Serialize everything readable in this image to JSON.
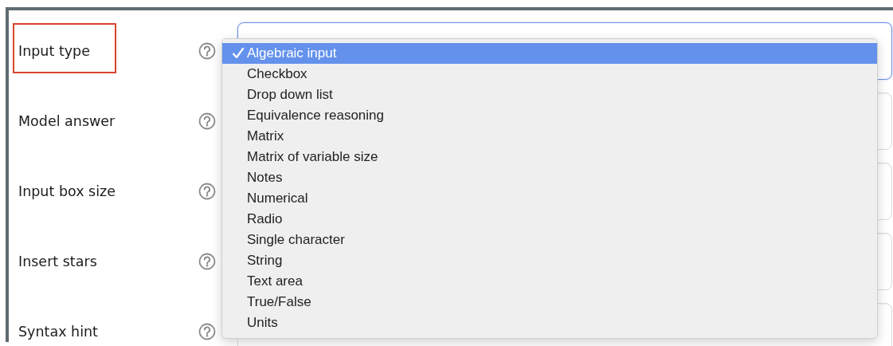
{
  "fields": [
    {
      "label": "Input type",
      "highlighted": true,
      "focused": true
    },
    {
      "label": "Model answer",
      "highlighted": false,
      "focused": false
    },
    {
      "label": "Input box size",
      "highlighted": false,
      "focused": false
    },
    {
      "label": "Insert stars",
      "highlighted": false,
      "focused": false
    },
    {
      "label": "Syntax hint",
      "highlighted": false,
      "focused": false
    }
  ],
  "dropdown": {
    "options": [
      {
        "label": "Algebraic input",
        "selected": true
      },
      {
        "label": "Checkbox",
        "selected": false
      },
      {
        "label": "Drop down list",
        "selected": false
      },
      {
        "label": "Equivalence reasoning",
        "selected": false
      },
      {
        "label": "Matrix",
        "selected": false
      },
      {
        "label": "Matrix of variable size",
        "selected": false
      },
      {
        "label": "Notes",
        "selected": false
      },
      {
        "label": "Numerical",
        "selected": false
      },
      {
        "label": "Radio",
        "selected": false
      },
      {
        "label": "Single character",
        "selected": false
      },
      {
        "label": "String",
        "selected": false
      },
      {
        "label": "Text area",
        "selected": false
      },
      {
        "label": "True/False",
        "selected": false
      },
      {
        "label": "Units",
        "selected": false
      }
    ]
  }
}
